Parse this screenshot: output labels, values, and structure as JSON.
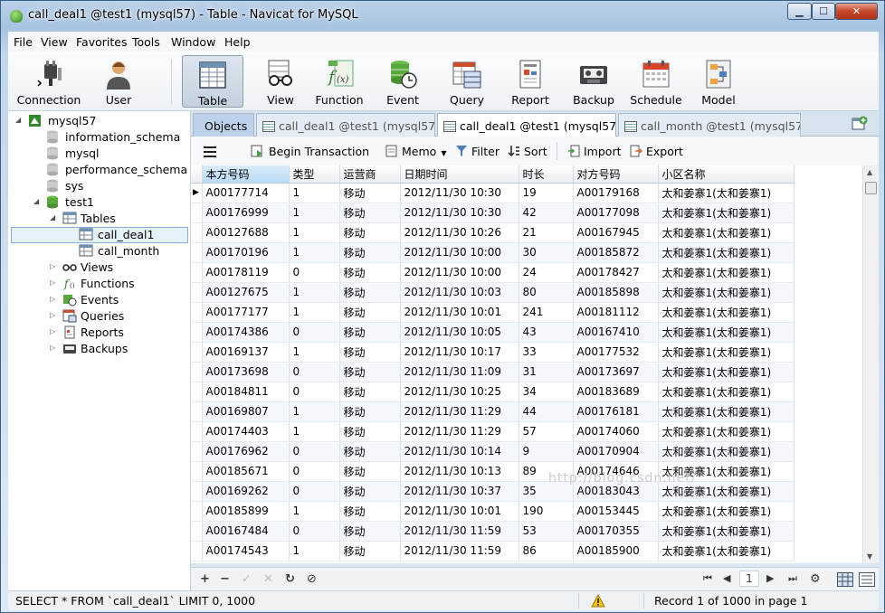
{
  "window": {
    "title": "call_deal1 @test1 (mysql57) - Table - Navicat for MySQL",
    "min": "▁",
    "max": "☐",
    "close": "✕"
  },
  "menu": [
    "File",
    "View",
    "Favorites",
    "Tools",
    "Window",
    "Help"
  ],
  "toolbar": {
    "connection": "Connection",
    "user": "User",
    "table": "Table",
    "view": "View",
    "function": "Function",
    "event": "Event",
    "query": "Query",
    "report": "Report",
    "backup": "Backup",
    "schedule": "Schedule",
    "model": "Model"
  },
  "tree": {
    "connection": "mysql57",
    "databases": [
      "information_schema",
      "mysql",
      "performance_schema",
      "sys"
    ],
    "active_db": "test1",
    "tables_label": "Tables",
    "tables": [
      "call_deal1",
      "call_month"
    ],
    "groups": [
      "Views",
      "Functions",
      "Events",
      "Queries",
      "Reports",
      "Backups"
    ]
  },
  "tabs": {
    "objects": "Objects",
    "tab1": "call_deal1 @test1 (mysql57)...",
    "tab2": "call_deal1 @test1 (mysql57)...",
    "tab3": "call_month @test1 (mysql57..."
  },
  "subtoolbar": {
    "begin": "Begin Transaction",
    "memo": "Memo",
    "filter": "Filter",
    "sort": "Sort",
    "import": "Import",
    "export": "Export"
  },
  "grid": {
    "columns": [
      "本方号码",
      "类型",
      "运营商",
      "日期时间",
      "时长",
      "对方号码",
      "小区名称"
    ],
    "rows": [
      [
        "A00177714",
        "1",
        "移动",
        "2012/11/30 10:30",
        "19",
        "A00179168",
        "太和姜寨1(太和姜寨1)"
      ],
      [
        "A00176999",
        "1",
        "移动",
        "2012/11/30 10:30",
        "42",
        "A00177098",
        "太和姜寨1(太和姜寨1)"
      ],
      [
        "A00127688",
        "1",
        "移动",
        "2012/11/30 10:26",
        "21",
        "A00167945",
        "太和姜寨1(太和姜寨1)"
      ],
      [
        "A00170196",
        "1",
        "移动",
        "2012/11/30 10:00",
        "30",
        "A00185872",
        "太和姜寨1(太和姜寨1)"
      ],
      [
        "A00178119",
        "0",
        "移动",
        "2012/11/30 10:00",
        "24",
        "A00178427",
        "太和姜寨1(太和姜寨1)"
      ],
      [
        "A00127675",
        "1",
        "移动",
        "2012/11/30 10:03",
        "80",
        "A00185898",
        "太和姜寨1(太和姜寨1)"
      ],
      [
        "A00177177",
        "1",
        "移动",
        "2012/11/30 10:01",
        "241",
        "A00181112",
        "太和姜寨1(太和姜寨1)"
      ],
      [
        "A00174386",
        "0",
        "移动",
        "2012/11/30 10:05",
        "43",
        "A00167410",
        "太和姜寨1(太和姜寨1)"
      ],
      [
        "A00169137",
        "1",
        "移动",
        "2012/11/30 10:17",
        "33",
        "A00177532",
        "太和姜寨1(太和姜寨1)"
      ],
      [
        "A00173698",
        "0",
        "移动",
        "2012/11/30 11:09",
        "31",
        "A00173697",
        "太和姜寨1(太和姜寨1)"
      ],
      [
        "A00184811",
        "0",
        "移动",
        "2012/11/30 10:25",
        "34",
        "A00183689",
        "太和姜寨1(太和姜寨1)"
      ],
      [
        "A00169807",
        "1",
        "移动",
        "2012/11/30 11:29",
        "44",
        "A00176181",
        "太和姜寨1(太和姜寨1)"
      ],
      [
        "A00174403",
        "1",
        "移动",
        "2012/11/30 11:29",
        "57",
        "A00174060",
        "太和姜寨1(太和姜寨1)"
      ],
      [
        "A00176962",
        "0",
        "移动",
        "2012/11/30 10:14",
        "9",
        "A00170904",
        "太和姜寨1(太和姜寨1)"
      ],
      [
        "A00185671",
        "0",
        "移动",
        "2012/11/30 10:13",
        "89",
        "A00174646",
        "太和姜寨1(太和姜寨1)"
      ],
      [
        "A00169262",
        "0",
        "移动",
        "2012/11/30 10:37",
        "35",
        "A00183043",
        "太和姜寨1(太和姜寨1)"
      ],
      [
        "A00185899",
        "1",
        "移动",
        "2012/11/30 10:01",
        "190",
        "A00153445",
        "太和姜寨1(太和姜寨1)"
      ],
      [
        "A00167484",
        "0",
        "移动",
        "2012/11/30 11:59",
        "53",
        "A00170355",
        "太和姜寨1(太和姜寨1)"
      ],
      [
        "A00174543",
        "1",
        "移动",
        "2012/11/30 11:59",
        "86",
        "A00185900",
        "太和姜寨1(太和姜寨1)"
      ]
    ],
    "watermark": "http://blog.csdn.net/"
  },
  "footer": {
    "page": "1"
  },
  "status": {
    "sql": "SELECT * FROM `call_deal1` LIMIT 0, 1000",
    "record": "Record 1 of 1000 in page 1"
  }
}
